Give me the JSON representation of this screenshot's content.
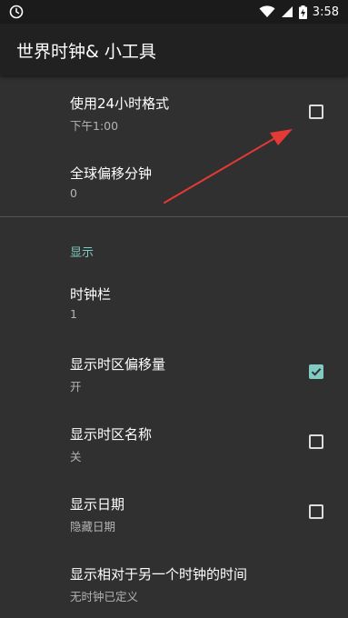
{
  "status_bar": {
    "time": "3:58",
    "icons": [
      "clock-icon",
      "wifi-icon",
      "signal-icon",
      "battery-charging-icon"
    ]
  },
  "app_bar": {
    "title": "世界时钟& 小工具"
  },
  "preferences": [
    {
      "title": "使用24小时格式",
      "summary": "下午1:00",
      "checkbox": "unchecked"
    },
    {
      "title": "全球偏移分钟",
      "summary": "0"
    }
  ],
  "category": {
    "label": "显示"
  },
  "display_preferences": [
    {
      "title": "时钟栏",
      "summary": "1"
    },
    {
      "title": "显示时区偏移量",
      "summary": "开",
      "checkbox": "checked"
    },
    {
      "title": "显示时区名称",
      "summary": "关",
      "checkbox": "unchecked"
    },
    {
      "title": "显示日期",
      "summary": "隐藏日期",
      "checkbox": "unchecked"
    },
    {
      "title": "显示相对于另一个时钟的时间",
      "summary": "无时钟已定义"
    }
  ],
  "colors": {
    "accent": "#80cbc4",
    "annotation_arrow": "#e53935"
  }
}
